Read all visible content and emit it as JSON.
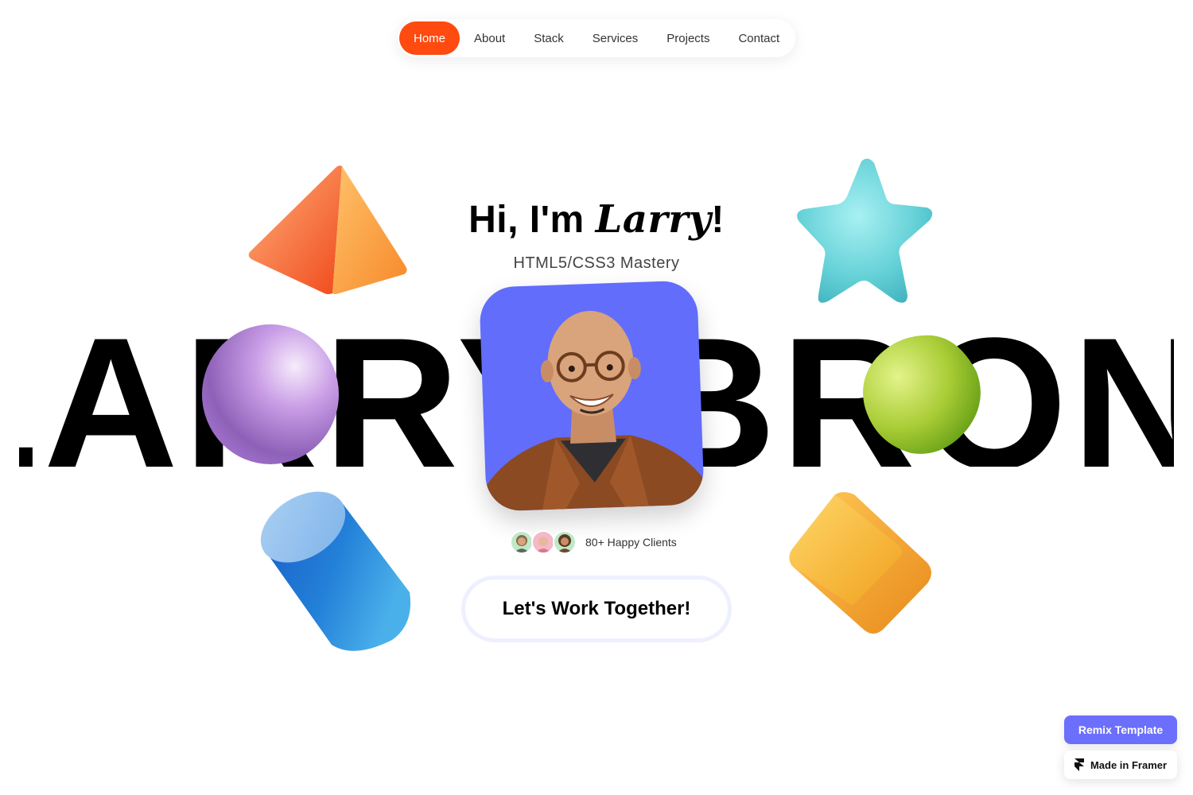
{
  "nav": {
    "items": [
      {
        "label": "Home",
        "active": true
      },
      {
        "label": "About",
        "active": false
      },
      {
        "label": "Stack",
        "active": false
      },
      {
        "label": "Services",
        "active": false
      },
      {
        "label": "Projects",
        "active": false
      },
      {
        "label": "Contact",
        "active": false
      }
    ],
    "accent": "#ff4a10"
  },
  "hero": {
    "greeting": "Hi, I'm ",
    "name": "Larry",
    "exclaim": "!",
    "subtitle": "HTML5/CSS3 Mastery",
    "marquee": "LARRY BRONX LARRY BRONX",
    "portrait_bg": "#626dfb"
  },
  "clients": {
    "label": "80+ Happy Clients",
    "avatar_colors": [
      "#bfe8c8",
      "#f5b8c8",
      "#bfe8c8"
    ]
  },
  "cta": {
    "label": "Let's Work Together!"
  },
  "framer": {
    "remix_label": "Remix Template",
    "made_label": "Made in Framer",
    "remix_color": "#6b6ffb"
  }
}
